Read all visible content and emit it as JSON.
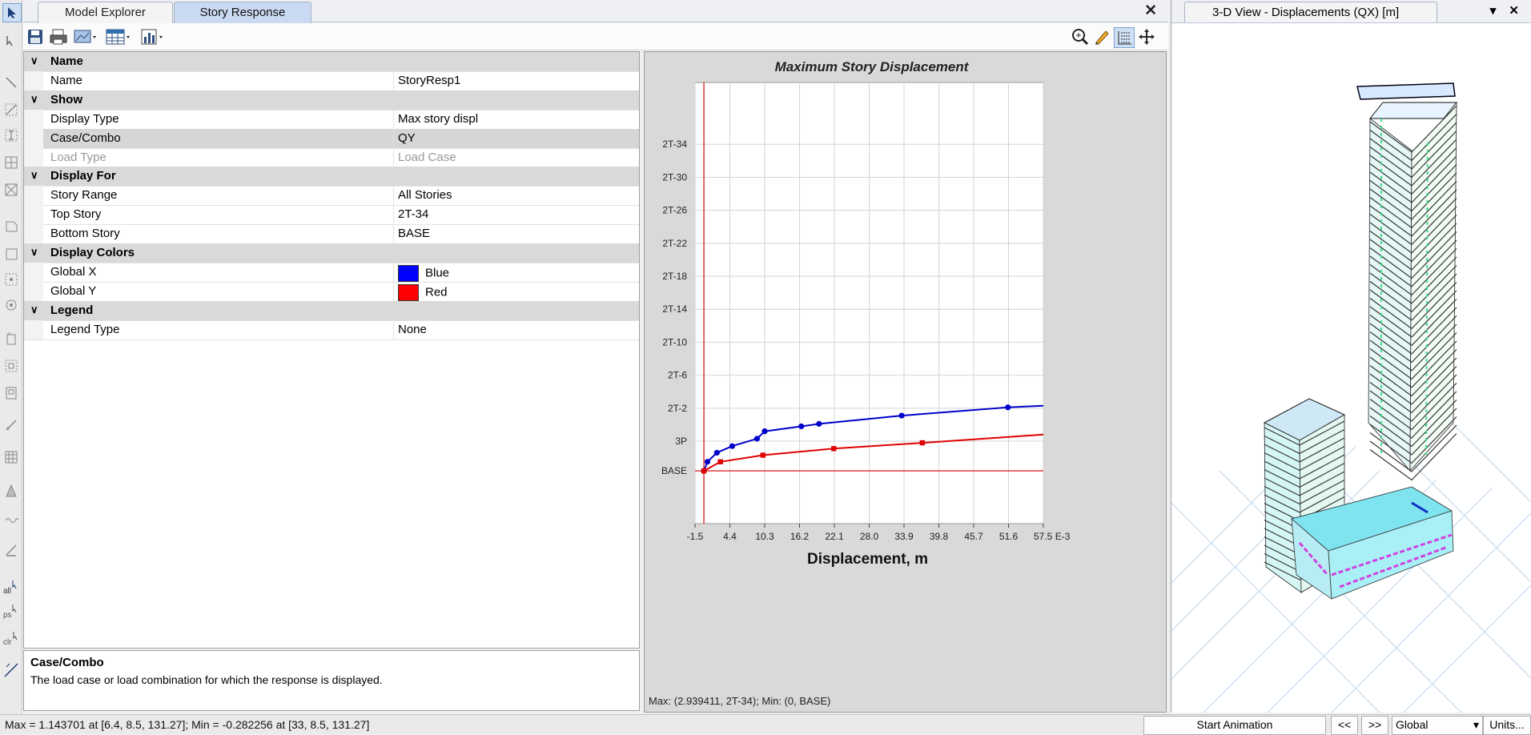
{
  "tabs": [
    {
      "label": "Model Explorer",
      "active": false
    },
    {
      "label": "Story Response",
      "active": true
    }
  ],
  "close_glyph": "✕",
  "toolbar_icons": [
    "save-icon",
    "print-icon",
    "display-icon",
    "table-icon",
    "chart-icon"
  ],
  "chart_toolbar_icons": [
    "zoom-icon",
    "pencil-icon",
    "grid-icon",
    "pan-icon"
  ],
  "property_grid": {
    "rows": [
      {
        "kind": "category",
        "label": "Name"
      },
      {
        "kind": "property",
        "name": "Name",
        "value": "StoryResp1"
      },
      {
        "kind": "category",
        "label": "Show"
      },
      {
        "kind": "property",
        "name": "Display Type",
        "value": "Max story displ"
      },
      {
        "kind": "property",
        "name": "Case/Combo",
        "value": "QY",
        "selected": true
      },
      {
        "kind": "property",
        "name": "Load Type",
        "value": "Load Case",
        "disabled": true
      },
      {
        "kind": "category",
        "label": "Display For"
      },
      {
        "kind": "property",
        "name": "Story Range",
        "value": "All Stories"
      },
      {
        "kind": "property",
        "name": "Top Story",
        "value": "2T-34"
      },
      {
        "kind": "property",
        "name": "Bottom Story",
        "value": "BASE"
      },
      {
        "kind": "category",
        "label": "Display Colors"
      },
      {
        "kind": "property",
        "name": "Global X",
        "value": "Blue",
        "swatch": "#0000ff"
      },
      {
        "kind": "property",
        "name": "Global Y",
        "value": "Red",
        "swatch": "#ff0000"
      },
      {
        "kind": "category",
        "label": "Legend"
      },
      {
        "kind": "property",
        "name": "Legend Type",
        "value": "None"
      }
    ]
  },
  "description": {
    "title": "Case/Combo",
    "text": "The load case or load combination for which the response is displayed."
  },
  "chart_data": {
    "type": "line",
    "title": "Maximum Story Displacement",
    "xlabel": "Displacement, m",
    "ylabel": "",
    "x_ticks": [
      "-1.5",
      "4.4",
      "10.3",
      "16.2",
      "22.1",
      "28.0",
      "33.9",
      "39.8",
      "45.7",
      "51.6",
      "57.5 E-3"
    ],
    "x_tick_values": [
      -1.5,
      4.4,
      10.3,
      16.2,
      22.1,
      28.0,
      33.9,
      39.8,
      45.7,
      51.6,
      57.5
    ],
    "xlim": [
      -1.5,
      57.5
    ],
    "y_ticks": [
      "2T-34",
      "2T-30",
      "2T-26",
      "2T-22",
      "2T-18",
      "2T-14",
      "2T-10",
      "2T-6",
      "2T-2",
      "3P",
      "BASE"
    ],
    "y_tick_values": [
      34,
      30,
      26,
      22,
      18,
      14,
      10,
      6,
      2,
      -2,
      -5.6
    ],
    "ylim": [
      -12,
      41.5
    ],
    "grid": true,
    "series": [
      {
        "name": "Global X",
        "color": "#0000cc",
        "points": [
          [
            0,
            -5.6
          ],
          [
            0.6,
            -4.5
          ],
          [
            2.2,
            -3.4
          ],
          [
            4.8,
            -2.6
          ],
          [
            9.0,
            -1.7
          ],
          [
            10.3,
            -0.8
          ],
          [
            16.5,
            -0.2
          ],
          [
            19.5,
            0.1
          ],
          [
            33.5,
            1.1
          ],
          [
            51.5,
            2.1
          ],
          [
            57.5,
            2.3
          ]
        ],
        "markers": [
          [
            0,
            -5.6
          ],
          [
            0.6,
            -4.5
          ],
          [
            2.2,
            -3.4
          ],
          [
            4.8,
            -2.6
          ],
          [
            9.0,
            -1.7
          ],
          [
            10.3,
            -0.8
          ],
          [
            16.5,
            -0.2
          ],
          [
            19.5,
            0.1
          ],
          [
            33.5,
            1.1
          ],
          [
            51.5,
            2.1
          ]
        ]
      },
      {
        "name": "Global Y",
        "color": "#e00000",
        "points": [
          [
            0,
            -5.6
          ],
          [
            2.8,
            -4.5
          ],
          [
            10.0,
            -3.7
          ],
          [
            22.0,
            -2.9
          ],
          [
            37.0,
            -2.2
          ],
          [
            57.5,
            -1.2
          ]
        ],
        "markers": [
          [
            0,
            -5.6
          ],
          [
            2.8,
            -4.5
          ],
          [
            10.0,
            -3.7
          ],
          [
            22.0,
            -2.9
          ],
          [
            37.0,
            -2.2
          ]
        ]
      }
    ],
    "reference_lines": {
      "vertical_x": 0,
      "horizontal_y": -5.6,
      "color": "#e00000"
    },
    "status": "Max: (2.939411, 2T-34);   Min: (0, BASE)"
  },
  "right_panel": {
    "tab_label": "3-D View   - Displacements (QX)  [m]",
    "controls": "▾ ✕"
  },
  "status_bar": {
    "text": "Max = 1.143701 at [6.4, 8.5, 131.27];  Min = -0.282256 at [33, 8.5, 131.27]",
    "start_animation": "Start Animation",
    "prev": "<<",
    "next": ">>",
    "coord_system": "Global",
    "units": "Units..."
  }
}
